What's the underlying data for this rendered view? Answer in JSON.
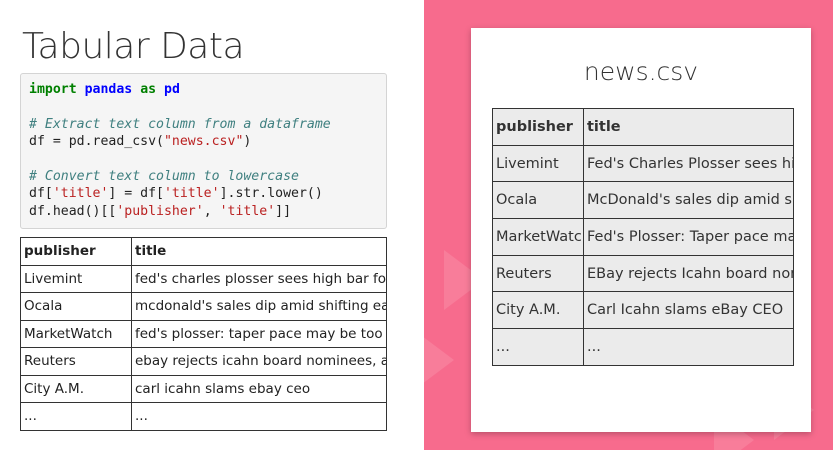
{
  "slide_title": "Tabular Data",
  "code": {
    "line1": {
      "kw1": "import",
      "mod": "pandas",
      "kw2": "as",
      "alias": "pd"
    },
    "comment1": "# Extract text column from a dataframe",
    "line3": {
      "pre": "df = pd.read_csv(",
      "str": "\"news.csv\"",
      "post": ")"
    },
    "comment2": "# Convert text column to lowercase",
    "line5": {
      "a": "df[",
      "s1": "'title'",
      "b": "] = df[",
      "s2": "'title'",
      "c": "].str.lower()"
    },
    "line6": {
      "a": "df.head()[[",
      "s1": "'publisher'",
      "b": ", ",
      "s2": "'title'",
      "c": "]]"
    }
  },
  "lower_table": {
    "headers": [
      "publisher",
      "title"
    ],
    "rows": [
      [
        "Livemint",
        "fed's charles plosser sees high bar for"
      ],
      [
        "Ocala",
        "mcdonald's sales dip amid shifting eati"
      ],
      [
        "MarketWatch",
        "fed's plosser: taper pace may be too sl"
      ],
      [
        "Reuters",
        "ebay rejects icahn board nominees, as"
      ],
      [
        "City A.M.",
        "carl icahn slams ebay ceo"
      ],
      [
        "...",
        "..."
      ]
    ]
  },
  "csv_card": {
    "title": "news.csv",
    "headers": [
      "publisher",
      "title"
    ],
    "rows": [
      [
        "Livemint",
        "Fed's Charles Plosser sees high"
      ],
      [
        "Ocala",
        "McDonald's sales dip amid shifti"
      ],
      [
        "MarketWatch",
        "Fed's Plosser: Taper pace may b"
      ],
      [
        "Reuters",
        "EBay rejects Icahn board nomin"
      ],
      [
        "City A.M.",
        "Carl Icahn slams eBay CEO"
      ],
      [
        "...",
        "..."
      ]
    ]
  },
  "colors": {
    "accent_background": "#f76b8d",
    "card_table_fill": "#ebebeb"
  }
}
